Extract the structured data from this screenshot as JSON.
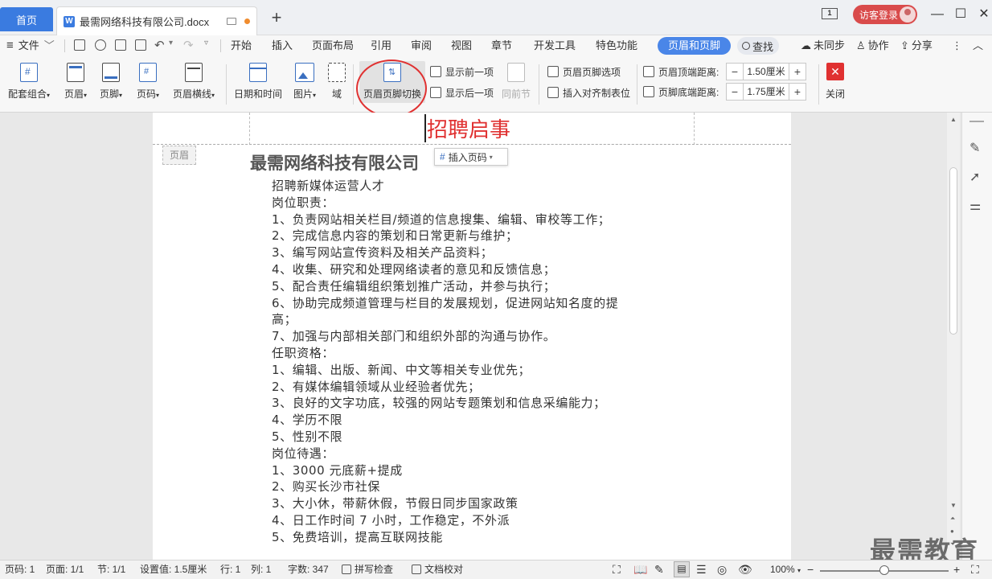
{
  "titlebar": {
    "home_tab": "首页",
    "doc_tab": "最需网络科技有限公司.docx",
    "doc_icon": "W",
    "new_tab": "+",
    "window_indicator": "1",
    "login": "访客登录",
    "minimize": "—",
    "maximize": "☐",
    "close": "✕"
  },
  "menu": {
    "file": "文件",
    "items": [
      "开始",
      "插入",
      "页面布局",
      "引用",
      "审阅",
      "视图",
      "章节",
      "开发工具",
      "特色功能"
    ],
    "active": "页眉和页脚",
    "find": "查找",
    "sync": "未同步",
    "collab": "协作",
    "share": "分享",
    "more": "⋮",
    "collapse": "︿"
  },
  "ribbon": {
    "btns": [
      {
        "label": "配套组合",
        "arrow": "▾"
      },
      {
        "label": "页眉",
        "arrow": "▾"
      },
      {
        "label": "页脚",
        "arrow": "▾"
      },
      {
        "label": "页码",
        "arrow": "▾"
      },
      {
        "label": "页眉横线",
        "arrow": "▾"
      },
      {
        "label": "日期和时间",
        "arrow": ""
      },
      {
        "label": "图片",
        "arrow": "▾"
      },
      {
        "label": "域",
        "arrow": ""
      },
      {
        "label": "页眉页脚切换",
        "arrow": ""
      }
    ],
    "show_prev": "显示前一项",
    "show_next": "显示后一项",
    "same_prev": "同前节",
    "hf_options": "页眉页脚选项",
    "insert_tab": "插入对齐制表位",
    "header_top_label": "页眉顶端距离:",
    "header_top_value": "1.50厘米",
    "footer_bottom_label": "页脚底端距离:",
    "footer_bottom_value": "1.75厘米",
    "minus": "−",
    "plus": "+",
    "close": "关闭"
  },
  "document": {
    "header_tag": "页眉",
    "header_title": "招聘启事",
    "insert_page_num": "插入页码",
    "company": "最需网络科技有限公司",
    "lines": [
      "招聘新媒体运营人才",
      "岗位职责：",
      "1、负责网站相关栏目/频道的信息搜集、编辑、审校等工作；",
      "2、完成信息内容的策划和日常更新与维护；",
      "3、编写网站宣传资料及相关产品资料；",
      "4、收集、研究和处理网络读者的意见和反馈信息；",
      "5、配合责任编辑组织策划推广活动，并参与执行；",
      "6、协助完成频道管理与栏目的发展规划，促进网站知名度的提",
      "高；",
      "7、加强与内部相关部门和组织外部的沟通与协作。",
      "    任职资格：",
      "1、编辑、出版、新闻、中文等相关专业优先；",
      "2、有媒体编辑领域从业经验者优先；",
      "3、良好的文字功底，较强的网站专题策划和信息采编能力；",
      "4、学历不限",
      "5、性别不限",
      "    岗位待遇：",
      "1、3000 元底薪+提成",
      "2、购买长沙市社保",
      "3、大小休，带薪休假，节假日同步国家政策",
      "4、日工作时间 7 小时，工作稳定，不外派",
      "5、免费培训，提高互联网技能"
    ]
  },
  "status": {
    "page_num": "页码: 1",
    "pages": "页面: 1/1",
    "section": "节: 1/1",
    "setting": "设置值: 1.5厘米",
    "row": "行: 1",
    "col": "列: 1",
    "words": "字数: 347",
    "spell": "拼写检查",
    "proof": "文档校对",
    "zoom": "100%",
    "zoom_minus": "−",
    "zoom_plus": "+",
    "zoom_level": 0.5
  },
  "watermark": "最需教育"
}
